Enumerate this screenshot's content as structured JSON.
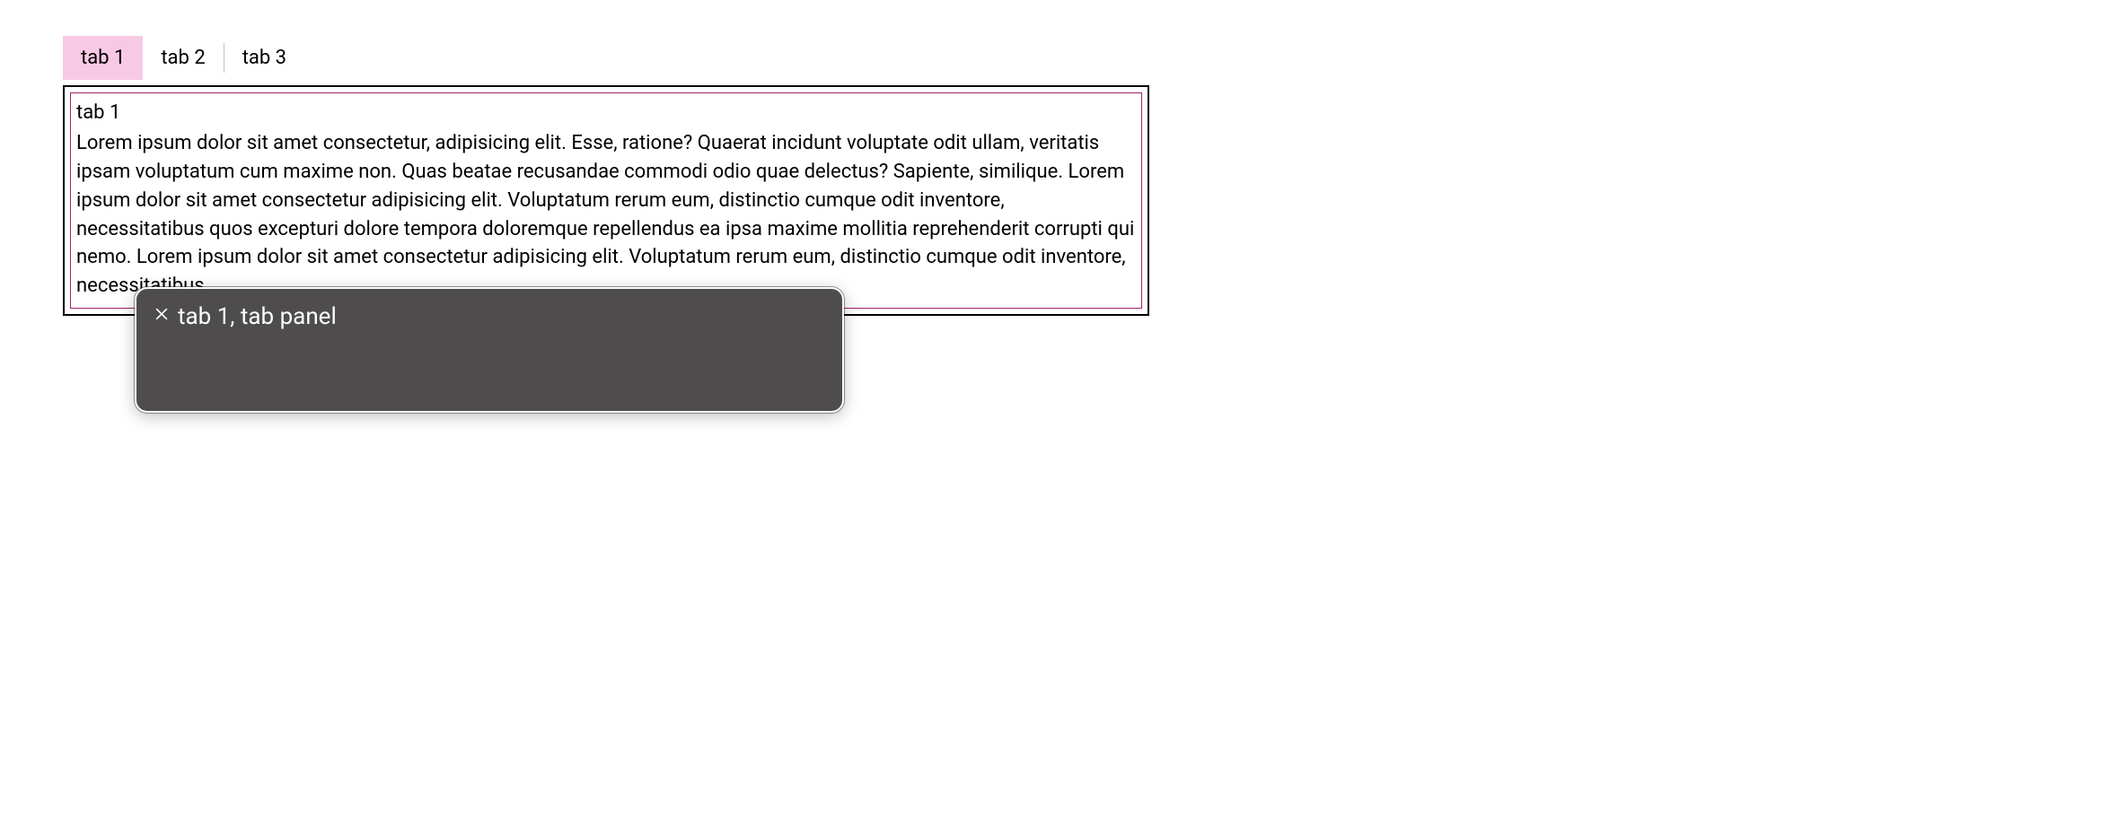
{
  "tabs": [
    {
      "label": "tab 1",
      "active": true
    },
    {
      "label": "tab 2",
      "active": false
    },
    {
      "label": "tab 3",
      "active": false
    }
  ],
  "panel": {
    "title": "tab 1",
    "body": "Lorem ipsum dolor sit amet consectetur, adipisicing elit. Esse, ratione? Quaerat incidunt voluptate odit ullam, veritatis ipsam voluptatum cum maxime non. Quas beatae recusandae commodi odio quae delectus? Sapiente, similique. Lorem ipsum dolor sit amet consectetur adipisicing elit. Voluptatum rerum eum, distinctio cumque odit inventore, necessitatibus quos excepturi dolore tempora doloremque repellendus ea ipsa maxime mollitia reprehenderit corrupti qui nemo. Lorem ipsum dolor sit amet consectetur adipisicing elit. Voluptatum rerum eum, distinctio cumque odit inventore, necessitatibus"
  },
  "tooltip": {
    "text": "tab 1, tab panel"
  },
  "colors": {
    "active_tab_bg": "#f8c9e4",
    "panel_inner_border": "#a31f6b",
    "tooltip_bg": "#4e4c4c"
  }
}
